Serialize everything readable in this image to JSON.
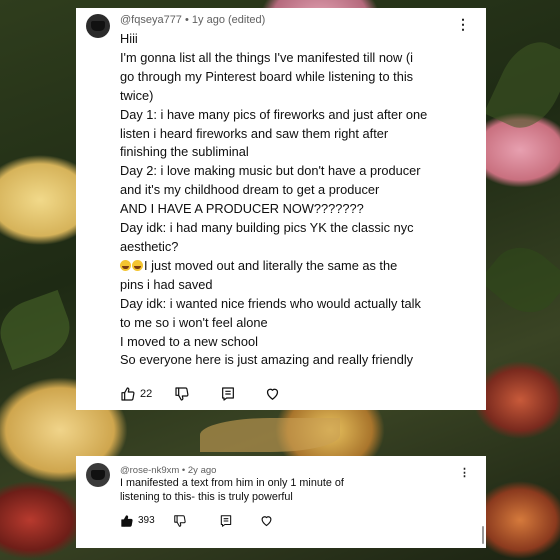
{
  "colors": {
    "card_bg": "#ffffff",
    "text": "#0f0f0f",
    "meta": "#606060"
  },
  "comment1": {
    "username": "@fqseya777",
    "time": "1y ago (edited)",
    "lines": [
      "Hiii",
      "I'm gonna list all the things I've manifested till now (i",
      "go through my Pinterest board while listening to this",
      "twice)",
      "Day 1: i have many pics of fireworks and just after one",
      "listen i heard fireworks and saw them right after",
      "finishing the subliminal",
      "Day 2: i love making music but don't have a producer",
      "and it's my childhood dream to get a producer",
      "AND I HAVE A PRODUCER NOW???????",
      "Day idk: i had many building pics YK the classic nyc",
      "aesthetic?",
      "I just moved out and literally the same as the",
      "pins i had saved",
      "Day idk: i wanted nice friends who would actually talk",
      "to me so i won't feel alone",
      "I moved to a new school",
      "So everyone here is just amazing and really friendly"
    ],
    "emoji_line_prefix": "😭😭",
    "likes": "22",
    "icons": [
      "thumbs-up-icon",
      "thumbs-down-icon",
      "reply-icon",
      "heart-icon",
      "more-vert-icon"
    ]
  },
  "comment2": {
    "username": "@rose-nk9xm",
    "time": "2y ago",
    "lines": [
      "I manifested a text from him in only 1 minute of",
      "listening to this- this is truly powerful"
    ],
    "likes": "393",
    "icons": [
      "thumbs-up-filled-icon",
      "thumbs-down-icon",
      "reply-icon",
      "heart-icon",
      "more-vert-icon"
    ]
  }
}
